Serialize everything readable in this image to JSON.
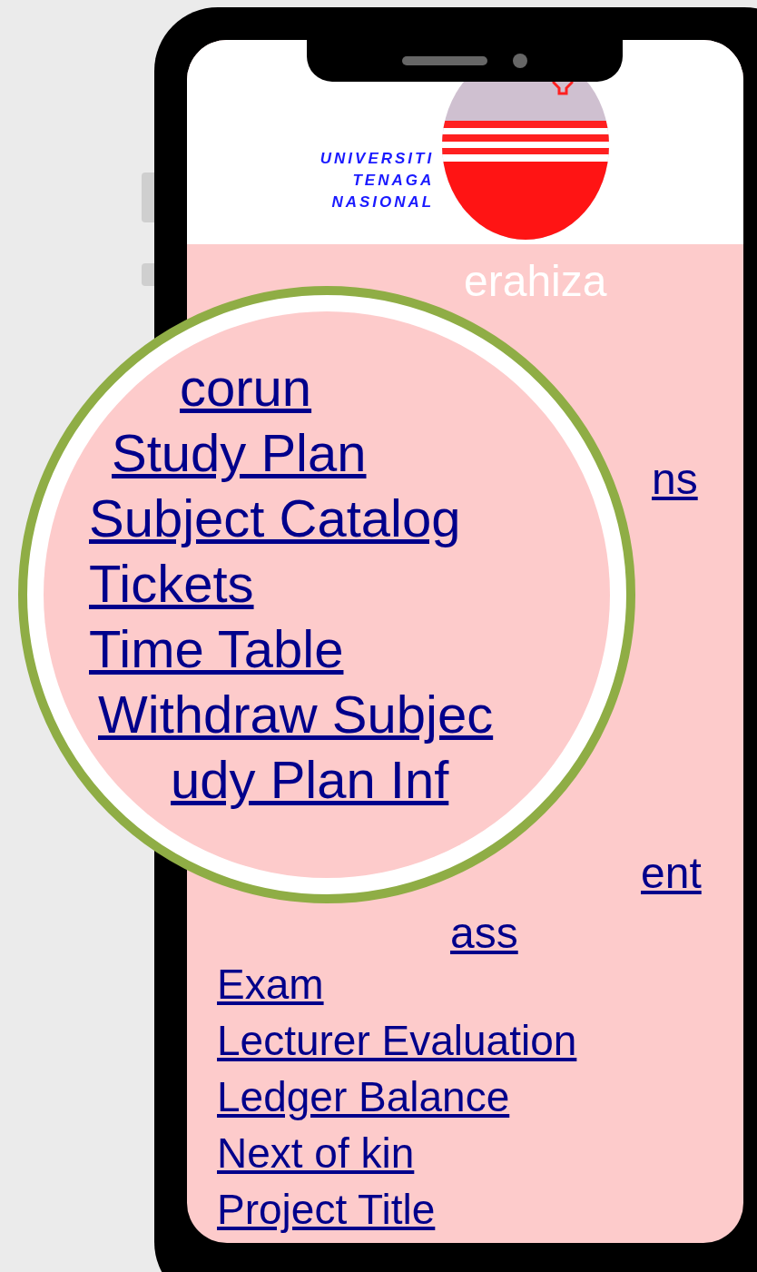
{
  "header": {
    "logo_lines": [
      "UNIVERSITI",
      "TENAGA",
      "NASIONAL"
    ]
  },
  "screen": {
    "fragments": [
      "erahiza",
      "ns",
      "ent",
      "ass"
    ],
    "links": [
      "Exam",
      "Lecturer Evaluation",
      "Ledger Balance",
      "Next of kin",
      "Project Title"
    ]
  },
  "magnifier": {
    "links": [
      "corun",
      "Study Plan",
      "Subject Catalog",
      "Tickets",
      "Time Table",
      "Withdraw Subjec",
      "udy Plan Inf"
    ]
  }
}
